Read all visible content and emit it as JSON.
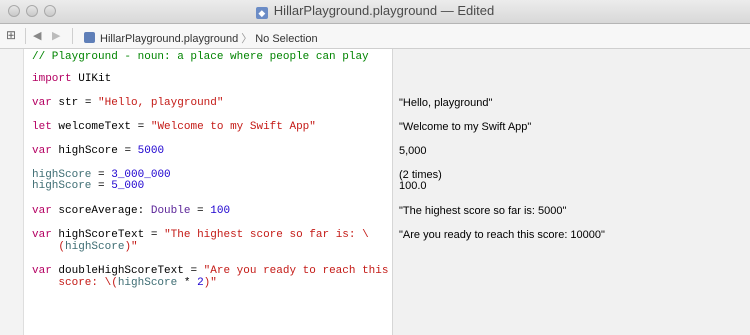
{
  "window": {
    "title": "HillarPlayground.playground — Edited"
  },
  "toolbar": {
    "file": "HillarPlayground.playground",
    "selection": "No Selection"
  },
  "code": {
    "comment": "// Playground - noun: a place where people can play",
    "import_kw": "import",
    "import_mod": "UIKit",
    "str_kw": "var",
    "str_name": "str",
    "str_eq": " = ",
    "str_val": "\"Hello, playground\"",
    "wt_kw": "let",
    "wt_name": "welcomeText",
    "wt_eq": " = ",
    "wt_val": "\"Welcome to my Swift App\"",
    "hs_kw": "var",
    "hs_name": "highScore",
    "hs_eq": " = ",
    "hs_val": "5000",
    "hs2_name": "highScore",
    "hs2_eq": " = ",
    "hs2_val": "3_000_000",
    "hs3_name": "highScore",
    "hs3_eq": " = ",
    "hs3_val": "5_000",
    "sa_kw": "var",
    "sa_name": "scoreAverage: ",
    "sa_type": "Double",
    "sa_eq": " = ",
    "sa_val": "100",
    "hst_kw": "var",
    "hst_name": "highScoreText",
    "hst_eq": " = ",
    "hst_val1": "\"The highest score so far is: \\",
    "hst_indent": "    ",
    "hst_interp_open": "(",
    "hst_interp_id": "highScore",
    "hst_interp_close": ")\"",
    "dhst_kw": "var",
    "dhst_name": "doubleHighScoreText",
    "dhst_eq": " = ",
    "dhst_val1": "\"Are you ready to reach this",
    "dhst_indent": "    ",
    "dhst_val2": "score: \\(",
    "dhst_id": "highScore",
    "dhst_op": " * ",
    "dhst_num": "2",
    "dhst_close": ")\""
  },
  "results": {
    "str": "\"Hello, playground\"",
    "welcome": "\"Welcome to my Swift App\"",
    "highscore": "5,000",
    "times": "(2 times)",
    "hs_value": "100.0",
    "score_avg": "\"The highest score so far is: 5000\"",
    "high_text": "\"Are you ready to reach this score: 10000\""
  }
}
